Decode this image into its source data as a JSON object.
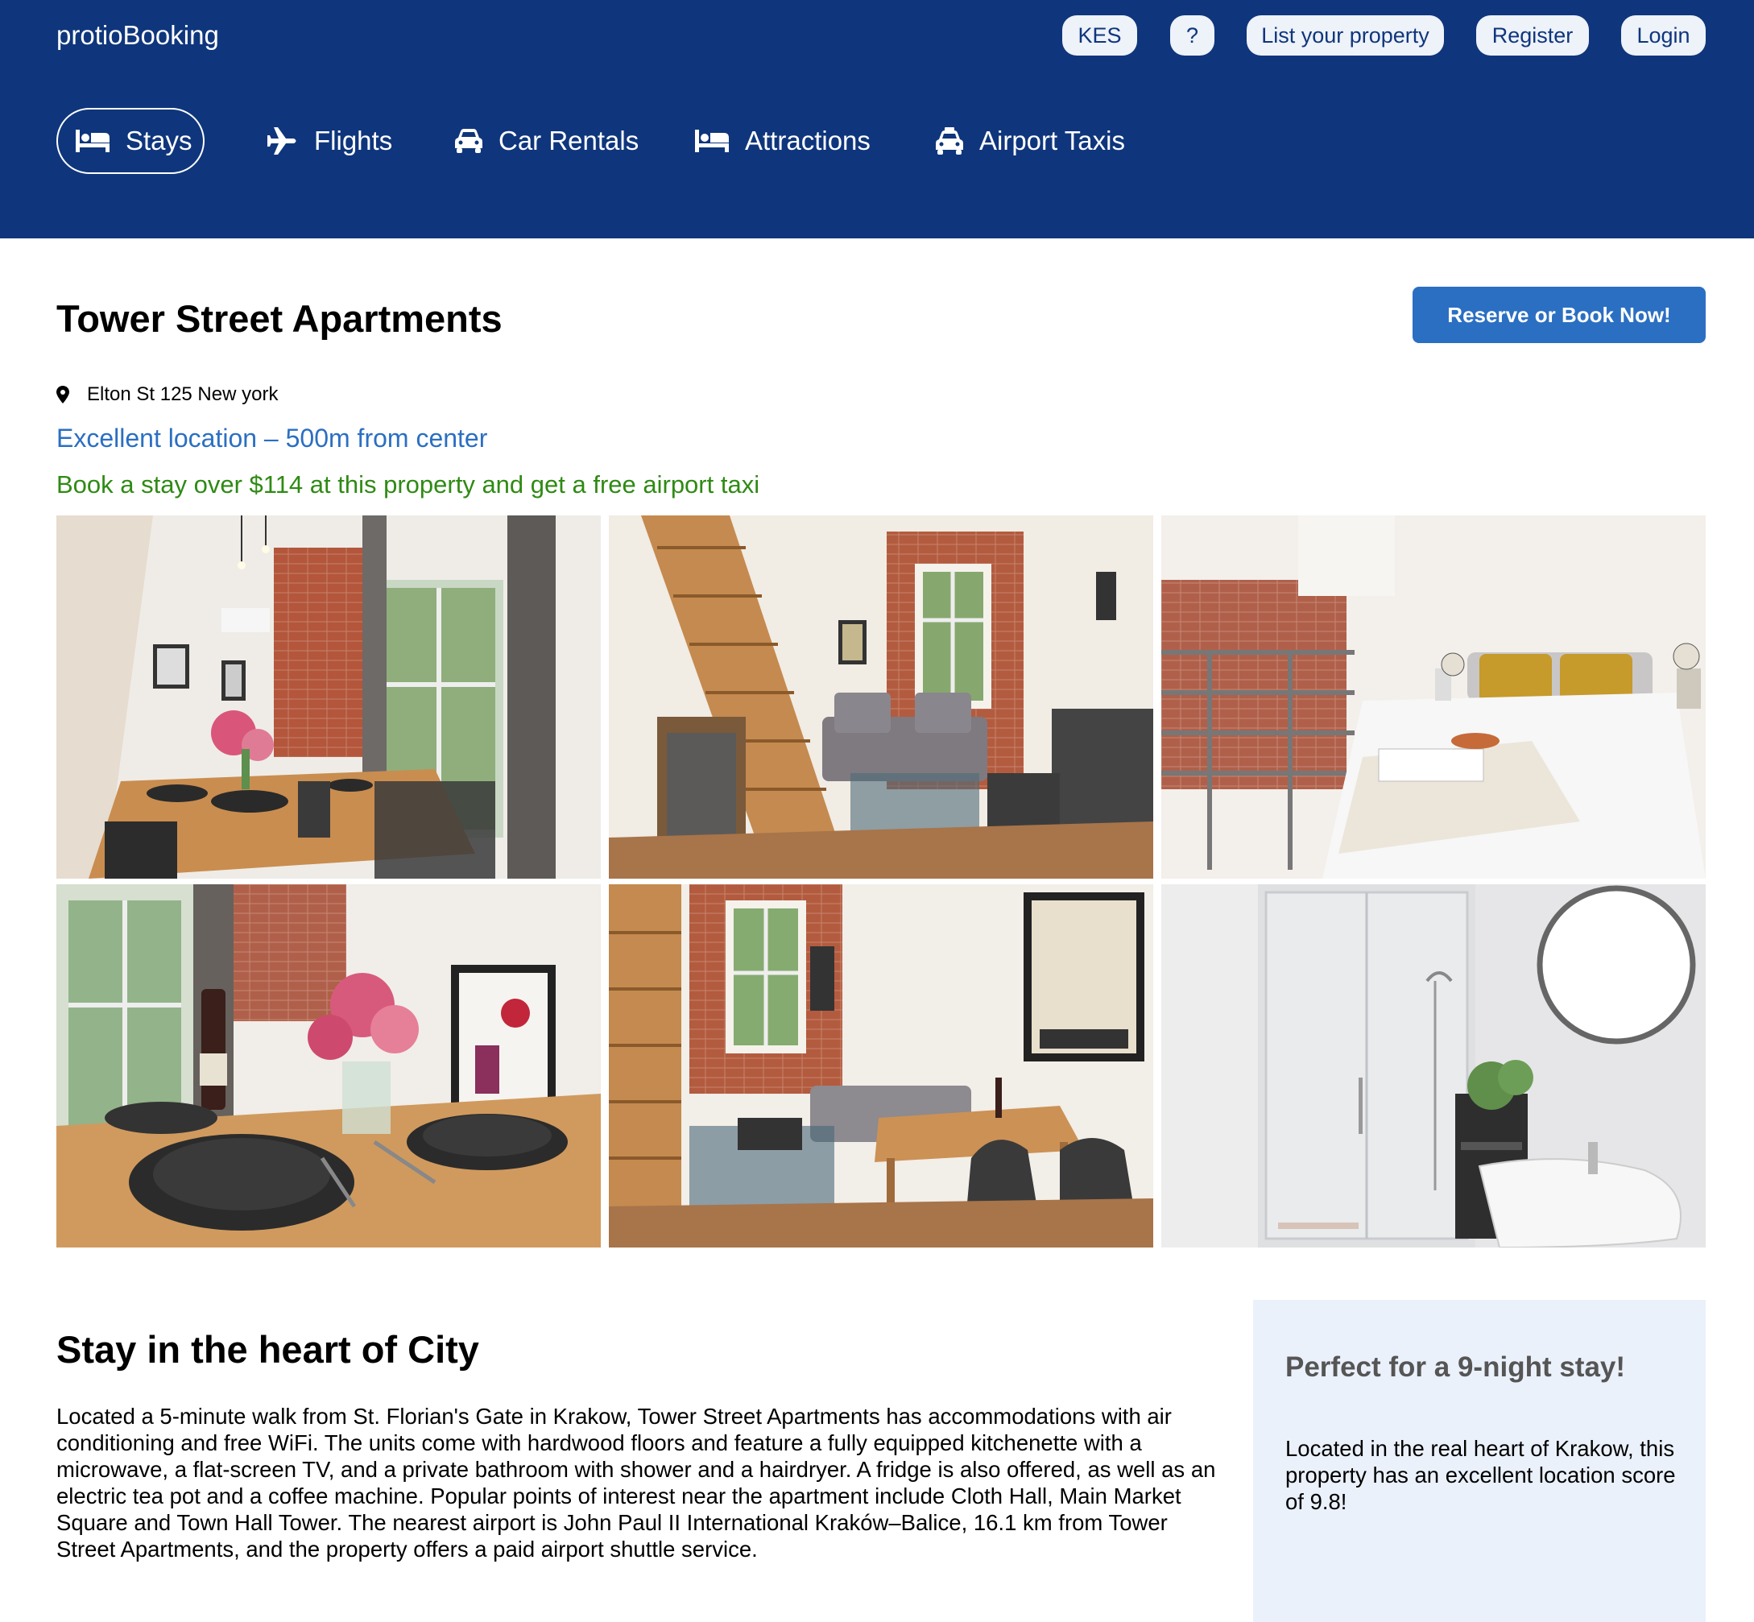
{
  "header": {
    "logo": "protioBooking",
    "buttons": {
      "currency": "KES",
      "help": "?",
      "list_property": "List your property",
      "register": "Register",
      "login": "Login"
    },
    "nav": [
      {
        "label": "Stays",
        "icon": "bed-icon",
        "active": true
      },
      {
        "label": "Flights",
        "icon": "plane-icon",
        "active": false
      },
      {
        "label": "Car Rentals",
        "icon": "car-icon",
        "active": false
      },
      {
        "label": "Attractions",
        "icon": "bed-icon",
        "active": false
      },
      {
        "label": "Airport Taxis",
        "icon": "taxi-icon",
        "active": false
      }
    ]
  },
  "property": {
    "title": "Tower Street Apartments",
    "reserve_label": "Reserve or Book Now!",
    "address_icon": "location-pin-icon",
    "address": "Elton St 125 New york",
    "location_note": "Excellent location – 500m from center",
    "taxi_offer": "Book a stay over $114 at this property and get a free airport taxi"
  },
  "gallery": [
    {
      "subject": "dining-room-photo"
    },
    {
      "subject": "living-room-stairs-photo"
    },
    {
      "subject": "bedroom-photo"
    },
    {
      "subject": "dining-table-closeup-photo"
    },
    {
      "subject": "living-dining-area-photo"
    },
    {
      "subject": "bathroom-photo"
    }
  ],
  "details": {
    "title": "Stay in the heart of City",
    "text": "Located a 5-minute walk from St. Florian's Gate in Krakow, Tower Street Apartments has accommodations with air conditioning and free WiFi. The units come with hardwood floors and feature a fully equipped kitchenette with a microwave, a flat-screen TV, and a private bathroom with shower and a hairdryer. A fridge is also offered, as well as an electric tea pot and a coffee machine. Popular points of interest near the apartment include Cloth Hall, Main Market Square and Town Hall Tower. The nearest airport is John Paul II International Kraków–Balice, 16.1 km from Tower Street Apartments, and the property offers a paid airport shuttle service."
  },
  "sidebar": {
    "title": "Perfect for a 9-night stay!",
    "text": "Located in the real heart of Krakow, this property has an excellent location score of 9.8!"
  },
  "colors": {
    "header_bg": "#0f367c",
    "accent": "#2b6fc2",
    "offer_green": "#2f8a14",
    "panel_bg": "#ebf1fb"
  }
}
